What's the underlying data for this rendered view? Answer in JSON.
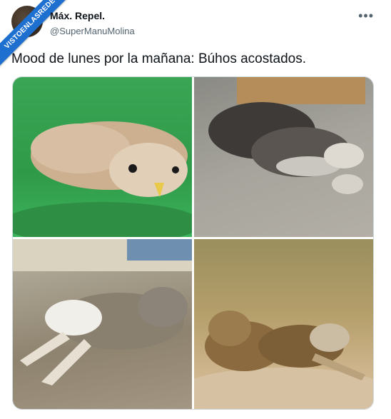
{
  "watermark": "VISTOENLASREDES",
  "tweet": {
    "display_name": "Máx. Repel.",
    "handle": "@SuperManuMolina",
    "text": "Mood de lunes por la mañana: Búhos acostados.",
    "more_icon": "more-icon"
  },
  "photos": [
    {
      "subject": "owl lying on green mat"
    },
    {
      "subject": "dark owl chick lying on sand"
    },
    {
      "subject": "fluffy owl chick lying on blanket"
    },
    {
      "subject": "burrowing owls lying on ground"
    }
  ]
}
